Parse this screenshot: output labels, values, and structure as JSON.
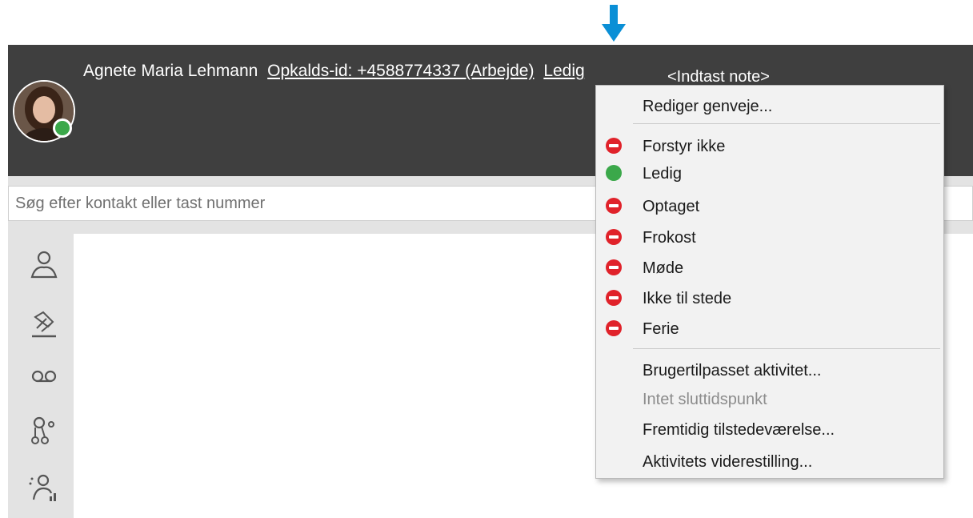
{
  "header": {
    "user_name": "Agnete Maria Lehmann",
    "call_id": "Opkalds-id: +4588774337 (Arbejde)",
    "status": "Ledig",
    "note_placeholder": "<Indtast note>"
  },
  "colors": {
    "header_bg": "#3f3f3f",
    "arrow": "#0a8fd6",
    "available": "#3ba84a",
    "busy": "#e0222a"
  },
  "search": {
    "placeholder": "Søg efter kontakt eller tast nummer",
    "value": ""
  },
  "sidebar": {
    "icons": [
      "contacts-icon",
      "call-handling-icon",
      "voicemail-icon",
      "queues-icon",
      "presence-stats-icon"
    ]
  },
  "status_menu": {
    "edit_shortcuts": "Rediger genveje...",
    "statuses": [
      {
        "label": "Forstyr ikke",
        "color": "red"
      },
      {
        "label": "Ledig",
        "color": "green"
      },
      {
        "label": "Optaget",
        "color": "red"
      },
      {
        "label": "Frokost",
        "color": "red"
      },
      {
        "label": "Møde",
        "color": "red"
      },
      {
        "label": "Ikke til stede",
        "color": "red"
      },
      {
        "label": "Ferie",
        "color": "red"
      }
    ],
    "custom_activity": "Brugertilpasset aktivitet...",
    "no_end_time": "Intet sluttidspunkt",
    "future_presence": "Fremtidig tilstedeværelse...",
    "activity_forwarding": "Aktivitets viderestilling..."
  }
}
